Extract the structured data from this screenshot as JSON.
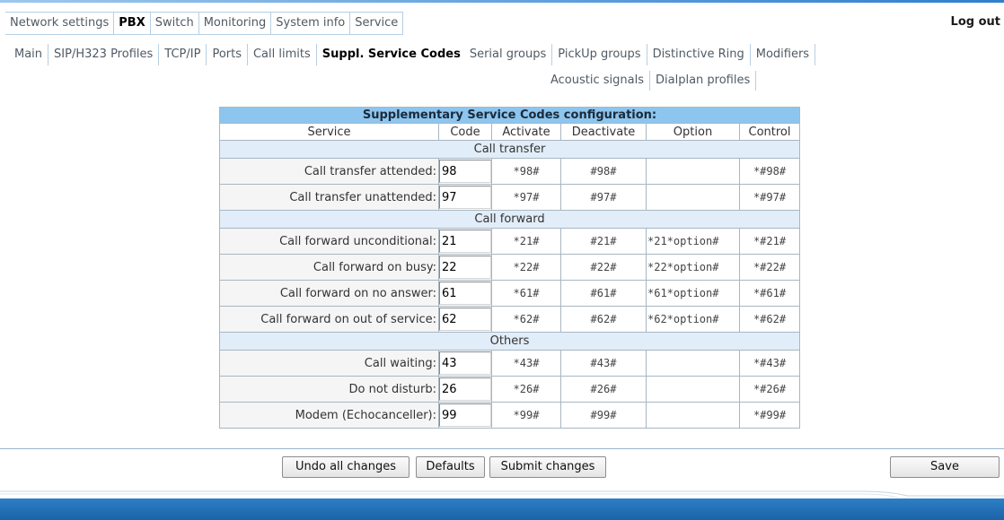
{
  "main_menu": {
    "items": [
      {
        "label": "Network settings"
      },
      {
        "label": "PBX",
        "active": true
      },
      {
        "label": "Switch"
      },
      {
        "label": "Monitoring"
      },
      {
        "label": "System info"
      },
      {
        "label": "Service"
      }
    ],
    "logout_label": "Log out"
  },
  "sub_menu": {
    "row1": [
      {
        "label": "Main"
      },
      {
        "label": "SIP/H323 Profiles"
      },
      {
        "label": "TCP/IP"
      },
      {
        "label": "Ports"
      },
      {
        "label": "Call limits"
      },
      {
        "label": "Suppl. Service Codes",
        "active": true
      },
      {
        "label": "Serial groups"
      },
      {
        "label": "PickUp groups"
      },
      {
        "label": "Distinctive Ring"
      },
      {
        "label": "Modifiers"
      }
    ],
    "row2": [
      {
        "label": "Acoustic signals"
      },
      {
        "label": "Dialplan profiles"
      }
    ]
  },
  "config": {
    "title": "Supplementary Service Codes configuration:",
    "headers": {
      "service": "Service",
      "code": "Code",
      "activate": "Activate",
      "deactivate": "Deactivate",
      "option": "Option",
      "control": "Control"
    },
    "sections": [
      {
        "name": "Call transfer",
        "rows": [
          {
            "service": "Call transfer attended:",
            "code": "98",
            "activate": "*98#",
            "deactivate": "#98#",
            "option": "",
            "control": "*#98#"
          },
          {
            "service": "Call transfer unattended:",
            "code": "97",
            "activate": "*97#",
            "deactivate": "#97#",
            "option": "",
            "control": "*#97#"
          }
        ]
      },
      {
        "name": "Call forward",
        "rows": [
          {
            "service": "Call forward unconditional:",
            "code": "21",
            "activate": "*21#",
            "deactivate": "#21#",
            "option": "*21*option#",
            "control": "*#21#"
          },
          {
            "service": "Call forward on busy:",
            "code": "22",
            "activate": "*22#",
            "deactivate": "#22#",
            "option": "*22*option#",
            "control": "*#22#"
          },
          {
            "service": "Call forward on no answer:",
            "code": "61",
            "activate": "*61#",
            "deactivate": "#61#",
            "option": "*61*option#",
            "control": "*#61#"
          },
          {
            "service": "Call forward on out of service:",
            "code": "62",
            "activate": "*62#",
            "deactivate": "#62#",
            "option": "*62*option#",
            "control": "*#62#"
          }
        ]
      },
      {
        "name": "Others",
        "rows": [
          {
            "service": "Call waiting:",
            "code": "43",
            "activate": "*43#",
            "deactivate": "#43#",
            "option": "",
            "control": "*#43#"
          },
          {
            "service": "Do not disturb:",
            "code": "26",
            "activate": "*26#",
            "deactivate": "#26#",
            "option": "",
            "control": "*#26#"
          },
          {
            "service": "Modem (Echocanceller):",
            "code": "99",
            "activate": "*99#",
            "deactivate": "#99#",
            "option": "",
            "control": "*#99#"
          }
        ]
      }
    ]
  },
  "buttons": {
    "undo": "Undo all changes",
    "defaults": "Defaults",
    "submit": "Submit changes",
    "save": "Save"
  },
  "colors": {
    "title_bar": "#8ec5ee",
    "section_bg": "#e1edf8",
    "footer": "#1c63a8"
  }
}
